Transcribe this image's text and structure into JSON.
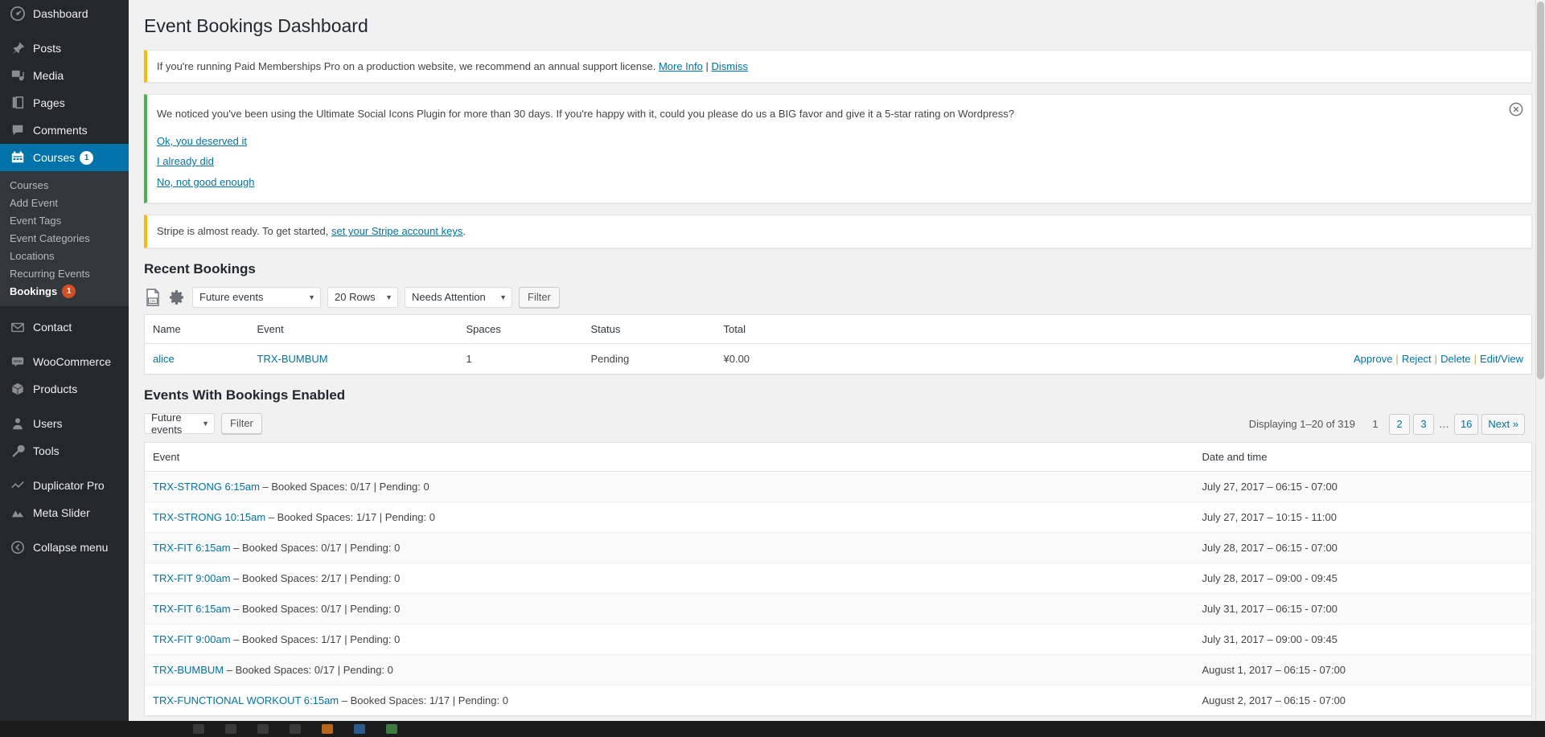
{
  "sidebar": {
    "items": [
      {
        "label": "Dashboard",
        "icon": "dashboard-icon",
        "name": "dashboard"
      },
      {
        "label": "Posts",
        "icon": "pin-icon",
        "name": "posts"
      },
      {
        "label": "Media",
        "icon": "media-icon",
        "name": "media"
      },
      {
        "label": "Pages",
        "icon": "pages-icon",
        "name": "pages"
      },
      {
        "label": "Comments",
        "icon": "comments-icon",
        "name": "comments"
      },
      {
        "label": "Courses",
        "icon": "calendar-icon",
        "name": "courses",
        "badge": "1",
        "current": true
      },
      {
        "label": "Contact",
        "icon": "envelope-icon",
        "name": "contact"
      },
      {
        "label": "WooCommerce",
        "icon": "woo-icon",
        "name": "woocommerce"
      },
      {
        "label": "Products",
        "icon": "box-icon",
        "name": "products"
      },
      {
        "label": "Users",
        "icon": "user-icon",
        "name": "users"
      },
      {
        "label": "Tools",
        "icon": "wrench-icon",
        "name": "tools"
      },
      {
        "label": "Duplicator Pro",
        "icon": "duplicator-icon",
        "name": "duplicator-pro"
      },
      {
        "label": "Meta Slider",
        "icon": "slider-icon",
        "name": "meta-slider"
      },
      {
        "label": "Collapse menu",
        "icon": "collapse-icon",
        "name": "collapse-menu"
      }
    ],
    "submenu": [
      {
        "label": "Courses",
        "active": false
      },
      {
        "label": "Add Event",
        "active": false
      },
      {
        "label": "Event Tags",
        "active": false
      },
      {
        "label": "Event Categories",
        "active": false
      },
      {
        "label": "Locations",
        "active": false
      },
      {
        "label": "Recurring Events",
        "active": false
      },
      {
        "label": "Bookings",
        "active": true,
        "badge": "1"
      }
    ]
  },
  "page": {
    "title": "Event Bookings Dashboard"
  },
  "notices": [
    {
      "name": "paid-memberships-pro-notice",
      "color": "#ffb900",
      "text_before": "If you're running Paid Memberships Pro on a production website, we recommend an annual support license. ",
      "link1": "More Info",
      "divider": " | ",
      "link2": "Dismiss",
      "text_after": ""
    },
    {
      "name": "ultimate-social-icons-notice",
      "color": "#46b450",
      "text_before": "We noticed you've been using the Ultimate Social Icons Plugin for more than 30 days. If you're happy with it, could you please do us a BIG favor and give it a 5-star rating on Wordpress?",
      "links": [
        "Ok, you deserved it",
        "I already did",
        "No, not good enough"
      ],
      "has_dismiss": true
    },
    {
      "name": "stripe-notice",
      "color": "#ffb900",
      "text_before": "Stripe is almost ready. To get started, ",
      "link1": "set your Stripe account keys",
      "text_after": "."
    }
  ],
  "recent_bookings": {
    "title": "Recent Bookings",
    "toolbar": {
      "csv_icon": "csv-icon",
      "gear_icon": "gear-icon",
      "scope_select": "Future events",
      "rows_select": "20 Rows",
      "status_select": "Needs Attention",
      "filter_button": "Filter"
    },
    "columns": [
      "Name",
      "Event",
      "Spaces",
      "Status",
      "Total",
      ""
    ],
    "rows": [
      {
        "name": "alice",
        "event": "TRX-BUMBUM",
        "spaces": "1",
        "status": "Pending",
        "total": "¥0.00",
        "actions": [
          "Approve",
          "Reject",
          "Delete",
          "Edit/View"
        ]
      }
    ]
  },
  "events_table": {
    "title": "Events With Bookings Enabled",
    "toolbar": {
      "scope_select": "Future events",
      "filter_button": "Filter"
    },
    "pagination": {
      "displaying": "Displaying 1–20 of 319",
      "current_page": "1",
      "pages": [
        "2",
        "3"
      ],
      "dots": "…",
      "last_page": "16",
      "next_label": "Next »"
    },
    "columns": [
      "Event",
      "Date and time"
    ],
    "rows": [
      {
        "link": "TRX-STRONG 6:15am",
        "detail": " – Booked Spaces: 0/17 | Pending: 0",
        "datetime": "July 27, 2017 – 06:15 - 07:00"
      },
      {
        "link": "TRX-STRONG 10:15am",
        "detail": " – Booked Spaces: 1/17 | Pending: 0",
        "datetime": "July 27, 2017 – 10:15 - 11:00"
      },
      {
        "link": "TRX-FIT 6:15am",
        "detail": " – Booked Spaces: 0/17 | Pending: 0",
        "datetime": "July 28, 2017 – 06:15 - 07:00"
      },
      {
        "link": "TRX-FIT 9:00am",
        "detail": " – Booked Spaces: 2/17 | Pending: 0",
        "datetime": "July 28, 2017 – 09:00 - 09:45"
      },
      {
        "link": "TRX-FIT 6:15am",
        "detail": " – Booked Spaces: 0/17 | Pending: 0",
        "datetime": "July 31, 2017 – 06:15 - 07:00"
      },
      {
        "link": "TRX-FIT 9:00am",
        "detail": " – Booked Spaces: 1/17 | Pending: 0",
        "datetime": "July 31, 2017 – 09:00 - 09:45"
      },
      {
        "link": "TRX-BUMBUM",
        "detail": " – Booked Spaces: 0/17 | Pending: 0",
        "datetime": "August 1, 2017 – 06:15 - 07:00"
      },
      {
        "link": "TRX-FUNCTIONAL WORKOUT 6:15am",
        "detail": " – Booked Spaces: 1/17 | Pending: 0",
        "datetime": "August 2, 2017 – 06:15 - 07:00"
      }
    ]
  },
  "colors": {
    "sidebar_bg": "#23282d",
    "submenu_bg": "#32373c",
    "current_blue": "#0073aa",
    "badge_orange": "#d54e21",
    "notice_yellow": "#ffb900",
    "notice_green": "#46b450",
    "link_blue": "#0073aa",
    "page_bg": "#f1f1f1"
  }
}
